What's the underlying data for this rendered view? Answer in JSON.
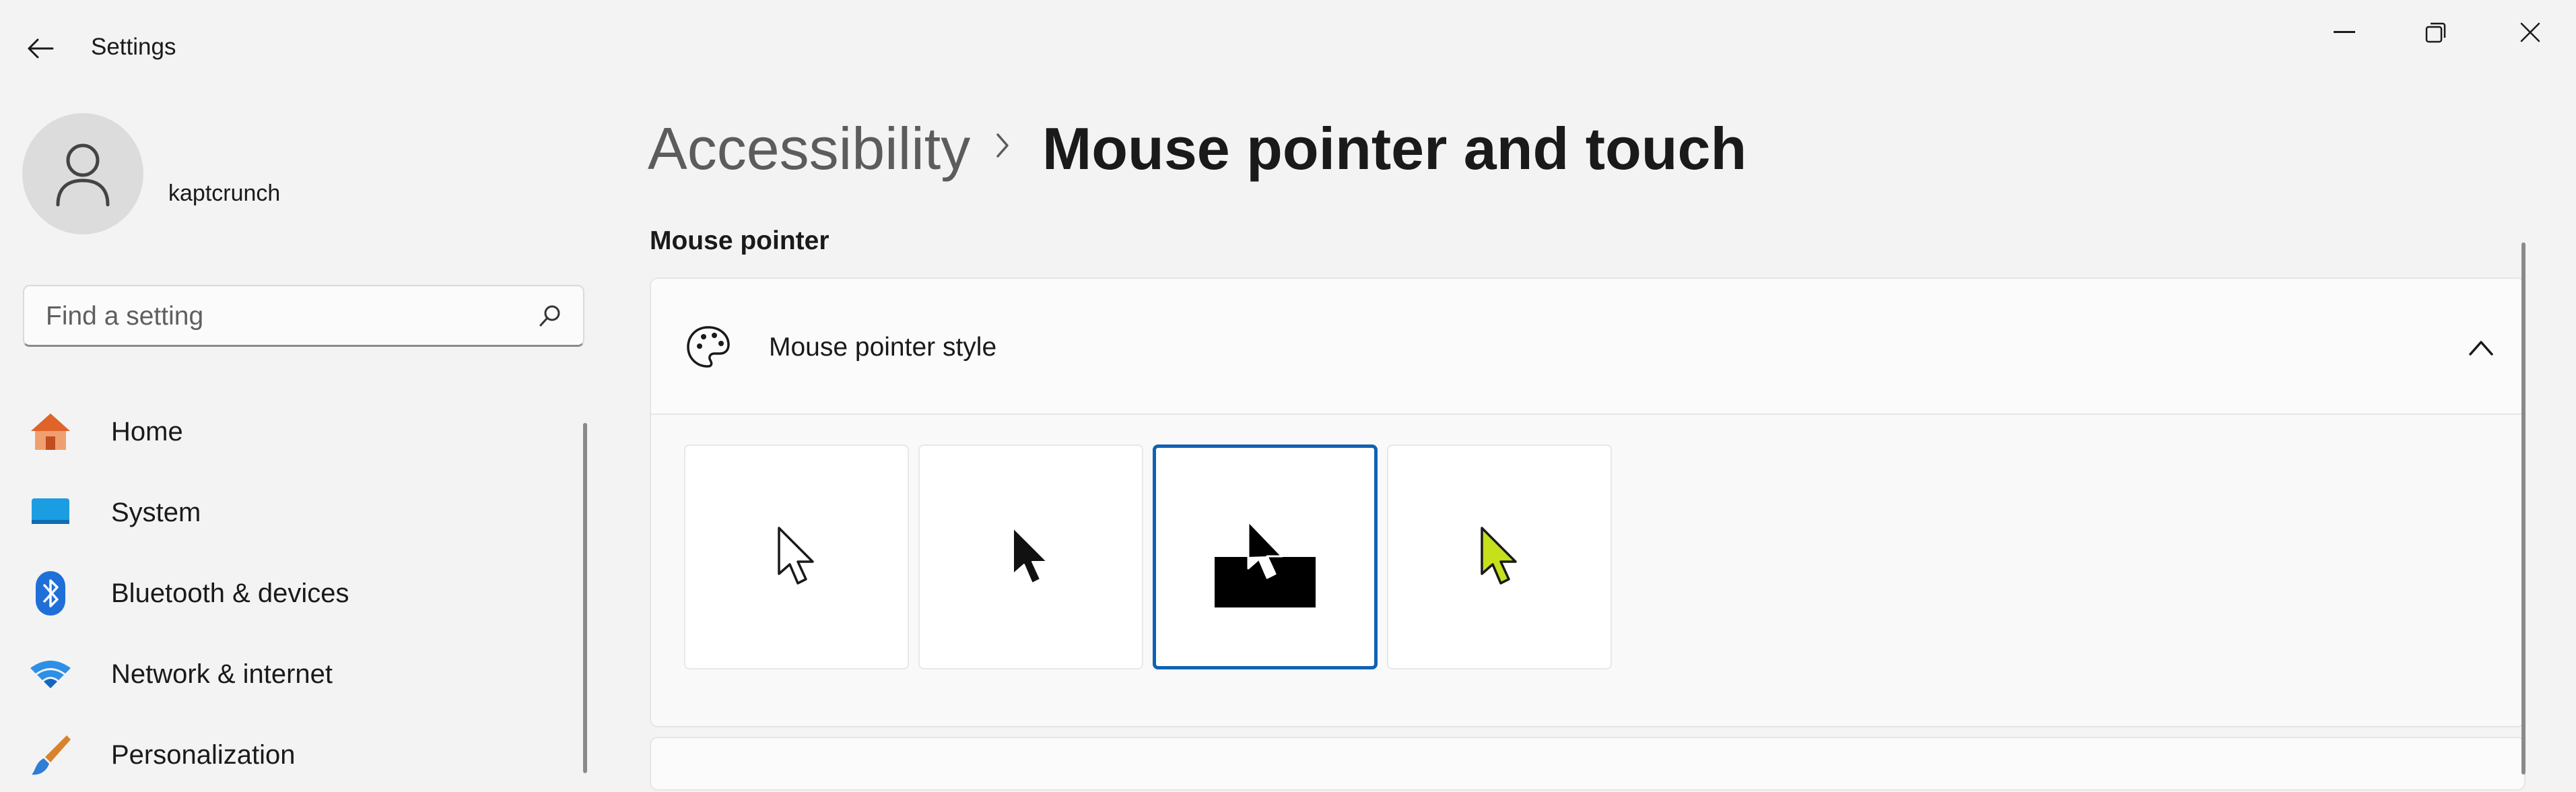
{
  "window": {
    "title": "Settings",
    "back_icon": "arrow-left-icon",
    "controls": [
      "minimize-icon",
      "restore-icon",
      "close-icon"
    ]
  },
  "user": {
    "name": "kaptcrunch",
    "avatar_icon": "person-icon"
  },
  "search": {
    "placeholder": "Find a setting",
    "value": "",
    "icon": "search-icon"
  },
  "sidebar": {
    "items": [
      {
        "label": "Home",
        "icon": "home-icon"
      },
      {
        "label": "System",
        "icon": "system-icon"
      },
      {
        "label": "Bluetooth & devices",
        "icon": "bluetooth-icon"
      },
      {
        "label": "Network & internet",
        "icon": "wifi-icon"
      },
      {
        "label": "Personalization",
        "icon": "brush-icon"
      }
    ]
  },
  "breadcrumb": {
    "parent": "Accessibility",
    "current": "Mouse pointer and touch"
  },
  "section": {
    "label": "Mouse pointer"
  },
  "pointer_style": {
    "title": "Mouse pointer style",
    "icon": "palette-icon",
    "expanded": true,
    "options": [
      {
        "name": "white",
        "selected": false
      },
      {
        "name": "black",
        "selected": false
      },
      {
        "name": "inverted",
        "selected": true
      },
      {
        "name": "custom",
        "selected": false,
        "color": "#c6e01b"
      }
    ]
  },
  "colors": {
    "accent": "#0f62b4",
    "background": "#f3f3f3",
    "card": "#fbfbfb"
  }
}
